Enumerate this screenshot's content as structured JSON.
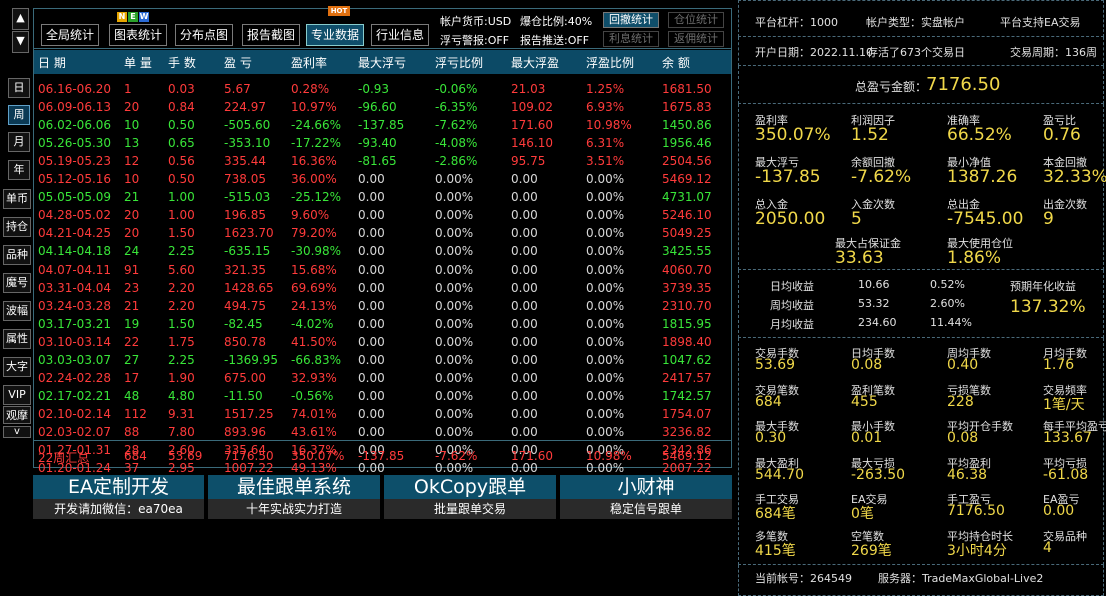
{
  "side": {
    "up": "▲",
    "down": "▼",
    "more": "v",
    "items": [
      "日",
      "周",
      "月",
      "年",
      "单币",
      "持仓",
      "品种",
      "魔号",
      "波幅",
      "属性",
      "大字",
      "VIP",
      "观摩"
    ]
  },
  "toolbar": {
    "buttons": [
      "全局统计",
      "图表统计",
      "分布点图",
      "报告截图",
      "专业数据",
      "行业信息"
    ],
    "badge_new": [
      "N",
      "E",
      "W"
    ],
    "badge_hot": "HOT",
    "currency": "帐户货币:USD",
    "margin_ratio": "爆仓比例:40%",
    "float_alert": "浮亏警报:OFF",
    "push": "报告推送:OFF",
    "small": [
      "回撤统计",
      "仓位统计",
      "利息统计",
      "返佣统计"
    ]
  },
  "table": {
    "headers": [
      "日 期",
      "单 量",
      "手 数",
      "盈 亏",
      "盈利率",
      "最大浮亏",
      "浮亏比例",
      "最大浮盈",
      "浮盈比例",
      "余 额"
    ],
    "rows": [
      {
        "c": "r",
        "v": [
          "06.16-06.20",
          "1",
          "0.03",
          "5.67",
          "0.28%",
          "-0.93",
          "-0.06%",
          "21.03",
          "1.25%",
          "1681.50"
        ]
      },
      {
        "c": "r",
        "v": [
          "06.09-06.13",
          "20",
          "0.84",
          "224.97",
          "10.97%",
          "-96.60",
          "-6.35%",
          "109.02",
          "6.93%",
          "1675.83"
        ]
      },
      {
        "c": "g",
        "v": [
          "06.02-06.06",
          "10",
          "0.50",
          "-505.60",
          "-24.66%",
          "-137.85",
          "-7.62%",
          "171.60",
          "10.98%",
          "1450.86"
        ]
      },
      {
        "c": "g",
        "v": [
          "05.26-05.30",
          "13",
          "0.65",
          "-353.10",
          "-17.22%",
          "-93.40",
          "-4.08%",
          "146.10",
          "6.31%",
          "1956.46"
        ]
      },
      {
        "c": "r",
        "v": [
          "05.19-05.23",
          "12",
          "0.56",
          "335.44",
          "16.36%",
          "-81.65",
          "-2.86%",
          "95.75",
          "3.51%",
          "2504.56"
        ]
      },
      {
        "c": "r",
        "v": [
          "05.12-05.16",
          "10",
          "0.50",
          "738.05",
          "36.00%",
          "0.00",
          "0.00%",
          "0.00",
          "0.00%",
          "5469.12"
        ]
      },
      {
        "c": "g",
        "v": [
          "05.05-05.09",
          "21",
          "1.00",
          "-515.03",
          "-25.12%",
          "0.00",
          "0.00%",
          "0.00",
          "0.00%",
          "4731.07"
        ]
      },
      {
        "c": "r",
        "v": [
          "04.28-05.02",
          "20",
          "1.00",
          "196.85",
          "9.60%",
          "0.00",
          "0.00%",
          "0.00",
          "0.00%",
          "5246.10"
        ]
      },
      {
        "c": "r",
        "v": [
          "04.21-04.25",
          "20",
          "1.50",
          "1623.70",
          "79.20%",
          "0.00",
          "0.00%",
          "0.00",
          "0.00%",
          "5049.25"
        ]
      },
      {
        "c": "g",
        "v": [
          "04.14-04.18",
          "24",
          "2.25",
          "-635.15",
          "-30.98%",
          "0.00",
          "0.00%",
          "0.00",
          "0.00%",
          "3425.55"
        ]
      },
      {
        "c": "r",
        "v": [
          "04.07-04.11",
          "91",
          "5.60",
          "321.35",
          "15.68%",
          "0.00",
          "0.00%",
          "0.00",
          "0.00%",
          "4060.70"
        ]
      },
      {
        "c": "r",
        "v": [
          "03.31-04.04",
          "23",
          "2.20",
          "1428.65",
          "69.69%",
          "0.00",
          "0.00%",
          "0.00",
          "0.00%",
          "3739.35"
        ]
      },
      {
        "c": "r",
        "v": [
          "03.24-03.28",
          "21",
          "2.20",
          "494.75",
          "24.13%",
          "0.00",
          "0.00%",
          "0.00",
          "0.00%",
          "2310.70"
        ]
      },
      {
        "c": "g",
        "v": [
          "03.17-03.21",
          "19",
          "1.50",
          "-82.45",
          "-4.02%",
          "0.00",
          "0.00%",
          "0.00",
          "0.00%",
          "1815.95"
        ]
      },
      {
        "c": "r",
        "v": [
          "03.10-03.14",
          "22",
          "1.75",
          "850.78",
          "41.50%",
          "0.00",
          "0.00%",
          "0.00",
          "0.00%",
          "1898.40"
        ]
      },
      {
        "c": "g",
        "v": [
          "03.03-03.07",
          "27",
          "2.25",
          "-1369.95",
          "-66.83%",
          "0.00",
          "0.00%",
          "0.00",
          "0.00%",
          "1047.62"
        ]
      },
      {
        "c": "r",
        "v": [
          "02.24-02.28",
          "17",
          "1.90",
          "675.00",
          "32.93%",
          "0.00",
          "0.00%",
          "0.00",
          "0.00%",
          "2417.57"
        ]
      },
      {
        "c": "g",
        "v": [
          "02.17-02.21",
          "48",
          "4.80",
          "-11.50",
          "-0.56%",
          "0.00",
          "0.00%",
          "0.00",
          "0.00%",
          "1742.57"
        ]
      },
      {
        "c": "r",
        "v": [
          "02.10-02.14",
          "112",
          "9.31",
          "1517.25",
          "74.01%",
          "0.00",
          "0.00%",
          "0.00",
          "0.00%",
          "1754.07"
        ]
      },
      {
        "c": "r",
        "v": [
          "02.03-02.07",
          "88",
          "7.80",
          "893.96",
          "43.61%",
          "0.00",
          "0.00%",
          "0.00",
          "0.00%",
          "3236.82"
        ]
      },
      {
        "c": "r",
        "v": [
          "01.27-01.31",
          "28",
          "2.60",
          "335.64",
          "16.37%",
          "0.00",
          "0.00%",
          "0.00",
          "0.00%",
          "2342.86"
        ]
      },
      {
        "c": "r",
        "v": [
          "01.20-01.24",
          "37",
          "2.95",
          "1007.22",
          "49.13%",
          "0.00",
          "0.00%",
          "0.00",
          "0.00%",
          "2007.22"
        ]
      }
    ],
    "summary": [
      "22周汇总",
      "684",
      "53.69",
      "7176.50",
      "350.07%",
      "-137.85",
      "-7.62%",
      "171.60",
      "10.98%",
      "5469.12"
    ]
  },
  "banners": [
    {
      "title": "EA定制开发",
      "sub": "开发请加微信：ea70ea"
    },
    {
      "title": "最佳跟单系统",
      "sub": "十年实战实力打造"
    },
    {
      "title": "OkCopy跟单",
      "sub": "批量跟单交易"
    },
    {
      "title": "小财神",
      "sub": "稳定信号跟单"
    }
  ],
  "panel": {
    "leverage": "平台杠杆：1000",
    "acct_type": "帐户类型：实盘帐户",
    "ea_support": "平台支持EA交易",
    "open_date": "开户日期：2022.11.10",
    "alive": "存活了673个交易日",
    "cycle": "交易周期：136周",
    "total_label": "总盈亏金额：",
    "total_value": "7176.50",
    "g1": [
      [
        "盈利率",
        "350.07%"
      ],
      [
        "利润因子",
        "1.52"
      ],
      [
        "准确率",
        "66.52%"
      ],
      [
        "盈亏比",
        "0.76"
      ],
      [
        "最大浮亏",
        "-137.85"
      ],
      [
        "余额回撤",
        "-7.62%"
      ],
      [
        "最小净值",
        "1387.26"
      ],
      [
        "本金回撤",
        "32.33%"
      ],
      [
        "总入金",
        "2050.00"
      ],
      [
        "入金次数",
        "5"
      ],
      [
        "总出金",
        "-7545.00"
      ],
      [
        "出金次数",
        "9"
      ]
    ],
    "g1b": [
      [
        "最大占保证金",
        "33.63"
      ],
      [
        "最大使用仓位",
        "1.86%"
      ]
    ],
    "avg": [
      [
        "日均收益",
        "10.66",
        "0.52%"
      ],
      [
        "周均收益",
        "53.32",
        "2.60%"
      ],
      [
        "月均收益",
        "234.60",
        "11.44%"
      ]
    ],
    "annual_label": "预期年化收益",
    "annual_value": "137.32%",
    "g2": [
      [
        "交易手数",
        "53.69"
      ],
      [
        "日均手数",
        "0.08"
      ],
      [
        "周均手数",
        "0.40"
      ],
      [
        "月均手数",
        "1.76"
      ],
      [
        "交易笔数",
        "684"
      ],
      [
        "盈利笔数",
        "455"
      ],
      [
        "亏损笔数",
        "228"
      ],
      [
        "交易频率",
        "1笔/天"
      ],
      [
        "最大手数",
        "0.30"
      ],
      [
        "最小手数",
        "0.01"
      ],
      [
        "平均开仓手数",
        "0.08"
      ],
      [
        "每手平均盈亏",
        "133.67"
      ],
      [
        "最大盈利",
        "544.70"
      ],
      [
        "最大亏损",
        "-263.50"
      ],
      [
        "平均盈利",
        "46.38"
      ],
      [
        "平均亏损",
        "-61.08"
      ],
      [
        "手工交易",
        "684笔"
      ],
      [
        "EA交易",
        "0笔"
      ],
      [
        "手工盈亏",
        "7176.50"
      ],
      [
        "EA盈亏",
        "0.00"
      ],
      [
        "多笔数",
        "415笔"
      ],
      [
        "空笔数",
        "269笔"
      ],
      [
        "平均持仓时长",
        "3小时4分"
      ],
      [
        "交易品种",
        "4"
      ]
    ],
    "account": "当前帐号：264549",
    "server": "服务器：TradeMaxGlobal-Live2"
  }
}
